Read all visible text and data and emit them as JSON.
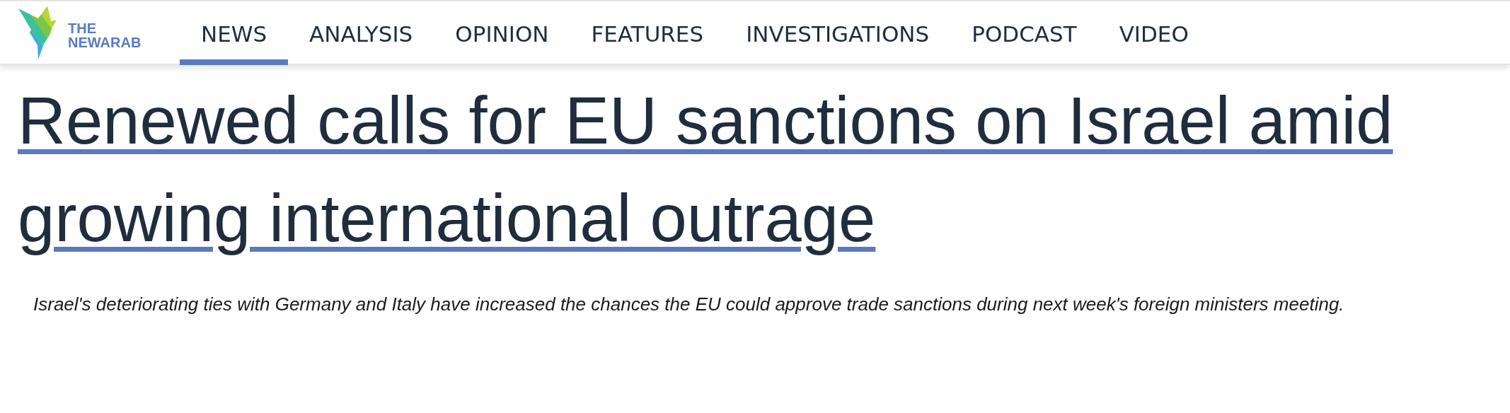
{
  "header": {
    "logo": {
      "lines": [
        "THE",
        "NEWARAB"
      ]
    },
    "nav": [
      {
        "label": "NEWS",
        "selected": true
      },
      {
        "label": "ANALYSIS",
        "selected": false
      },
      {
        "label": "OPINION",
        "selected": false
      },
      {
        "label": "FEATURES",
        "selected": false
      },
      {
        "label": "INVESTIGATIONS",
        "selected": false
      },
      {
        "label": "PODCAST",
        "selected": false
      },
      {
        "label": "VIDEO",
        "selected": false
      }
    ]
  },
  "article": {
    "headline": "Renewed calls for EU sanctions on Israel amid growing international outrage",
    "summary": "Israel's deteriorating ties with Germany and Italy have increased the chances the EU could approve trade sanctions during next week's foreign ministers meeting."
  }
}
